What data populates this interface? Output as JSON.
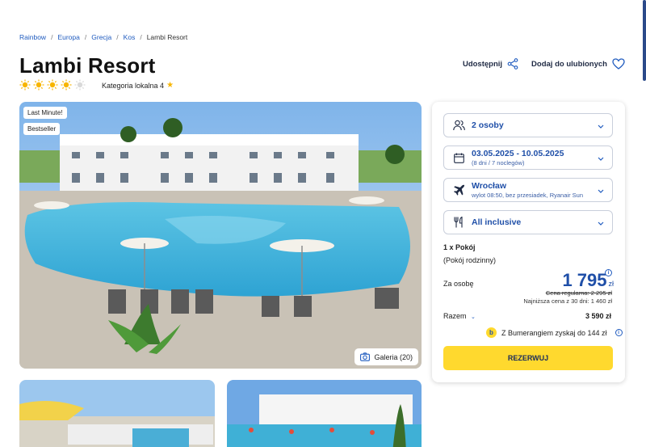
{
  "breadcrumb": [
    "Rainbow",
    "Europa",
    "Grecja",
    "Kos",
    "Lambi Resort"
  ],
  "hotel": {
    "title": "Lambi Resort",
    "sun_rating": 4,
    "sun_max": 5,
    "category_label": "Kategoria lokalna 4"
  },
  "actions": {
    "share": "Udostępnij",
    "favorite": "Dodaj do ulubionych"
  },
  "hero": {
    "badges": [
      "Last Minute!",
      "Bestseller"
    ],
    "gallery_label": "Galeria (20)"
  },
  "booking": {
    "persons": "2 osoby",
    "dates": "03.05.2025 - 10.05.2025",
    "dates_sub": "(8 dni / 7 noclegów)",
    "departure": "Wrocław",
    "departure_sub": "wylot 08:50, bez przesiadek, Ryanair Sun",
    "board": "All inclusive",
    "room_count": "1 x Pokój",
    "room_type": "(Pokój rodzinny)",
    "per_person_label": "Za osobę",
    "price": "1 795",
    "currency": "zł",
    "regular_price": "Cena regularna: 2 295 zł",
    "lowest_price": "Najniższa cena z 30 dni: 1 460 zł",
    "total_label": "Razem",
    "total_value": "3 590 zł",
    "bumerang": "Z Bumerangiem zyskaj do 144 zł",
    "book_button": "REZERWUJ"
  },
  "colors": {
    "accent": "#1f4fa8",
    "button": "#ffd92e",
    "sun": "#f7b500"
  }
}
